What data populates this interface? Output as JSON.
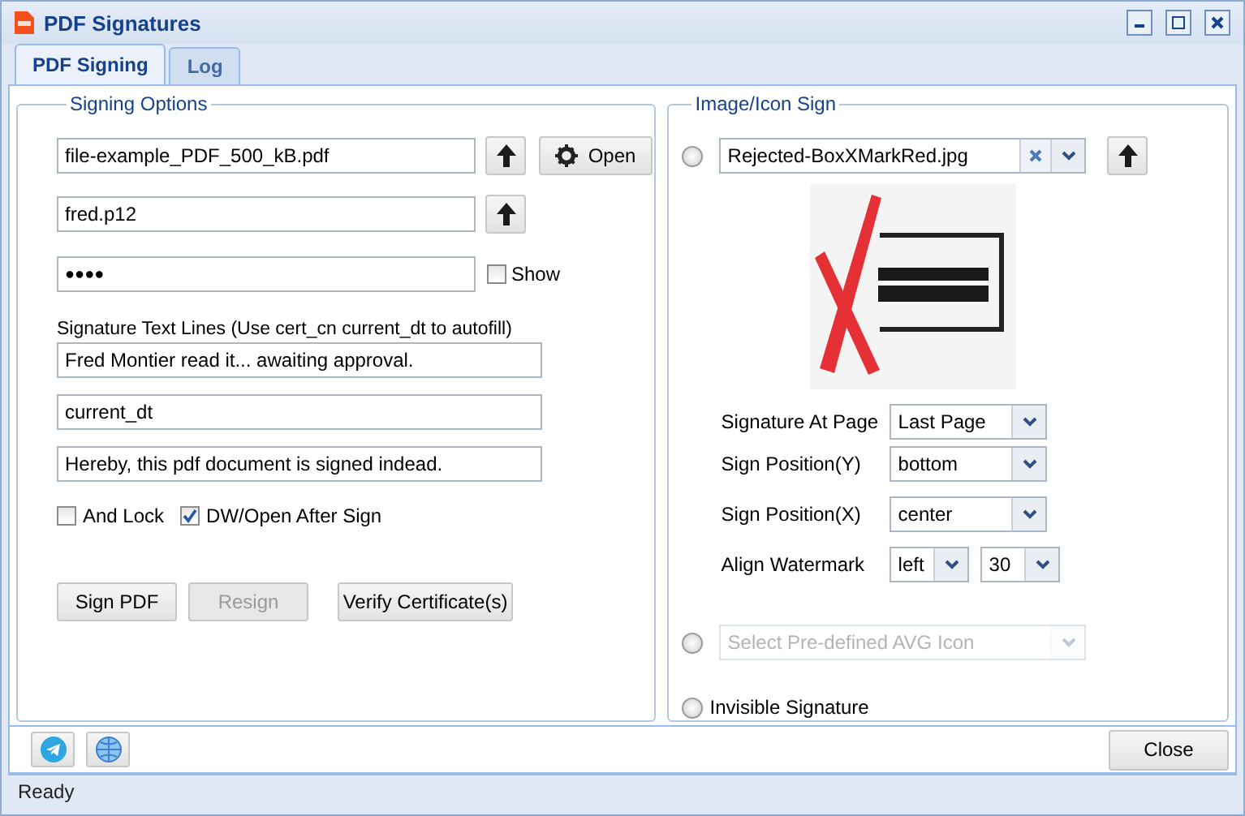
{
  "window": {
    "title": "PDF Signatures"
  },
  "tabs": [
    {
      "label": "PDF Signing",
      "selected": true
    },
    {
      "label": "Log",
      "selected": false
    }
  ],
  "signing_options": {
    "title": "Signing Options",
    "pdf_file": {
      "value": "file-example_PDF_500_kB.pdf"
    },
    "open_button": "Open",
    "certificate_file": {
      "value": "fred.p12"
    },
    "password": {
      "value": "●●●●"
    },
    "show_password": {
      "label": "Show",
      "checked": false
    },
    "text_lines_label": "Signature Text Lines (Use cert_cn current_dt to autofill)",
    "text_lines": [
      "Fred Montier read it... awaiting approval.",
      "current_dt",
      "Hereby, this pdf document is signed indead."
    ],
    "options": [
      {
        "label": "And Lock",
        "checked": false
      },
      {
        "label": "DW/Open After Sign",
        "checked": true
      }
    ],
    "buttons": [
      {
        "label": "Sign PDF",
        "disabled": false
      },
      {
        "label": "Resign",
        "disabled": true
      },
      {
        "label": "Verify Certificate(s)",
        "disabled": false
      }
    ]
  },
  "image_sign": {
    "title": "Image/Icon Sign",
    "image_mode": {
      "selected": false,
      "value": "Rejected-BoxXMarkRed.jpg"
    },
    "settings": [
      {
        "label": "Signature At Page",
        "values": [
          "Last Page"
        ]
      },
      {
        "label": "Sign Position(Y)",
        "values": [
          "bottom"
        ]
      },
      {
        "label": "Sign Position(X)",
        "values": [
          "center"
        ]
      },
      {
        "label": "Align Watermark",
        "values": [
          "left",
          "30"
        ]
      }
    ],
    "icon_mode": {
      "selected": false,
      "disabled": true,
      "placeholder": "Select Pre-defined AVG Icon"
    },
    "invisible_mode": {
      "selected": false,
      "label": "Invisible Signature"
    }
  },
  "footer": {
    "close_button": "Close"
  },
  "status_bar": "Ready"
}
